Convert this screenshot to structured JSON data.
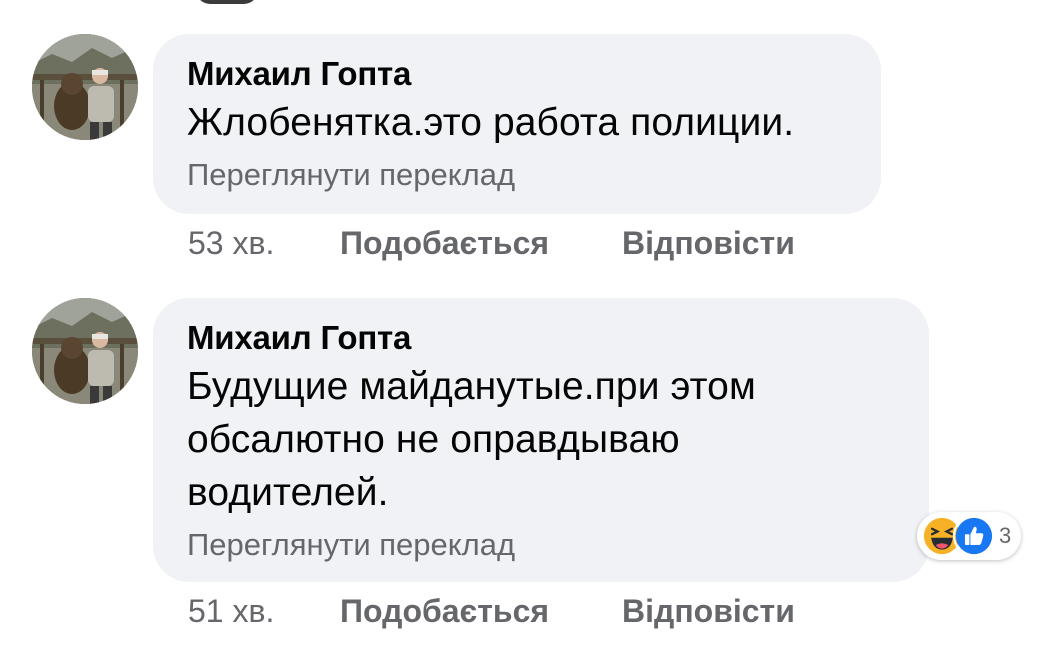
{
  "comments": [
    {
      "author": "Михаил Гопта",
      "text": "Жлобенятка.это работа полиции.",
      "translate_label": "Переглянути переклад",
      "time": "53 хв.",
      "like_label": "Подобається",
      "reply_label": "Відповісти"
    },
    {
      "author": "Михаил Гопта",
      "text_lines": [
        "Будущие майданутые.при этом",
        "обсалютно не оправдываю",
        "водителей."
      ],
      "translate_label": "Переглянути переклад",
      "time": "51 хв.",
      "like_label": "Подобається",
      "reply_label": "Відповісти",
      "reactions": {
        "icons": [
          "haha-icon",
          "like-icon"
        ],
        "count": "3"
      }
    }
  ],
  "colors": {
    "bubble": "#f0f2f5",
    "secondary_text": "#65676b",
    "primary_text": "#050505",
    "like_blue": "#1877f2",
    "haha_yellow": "#f7b125"
  }
}
